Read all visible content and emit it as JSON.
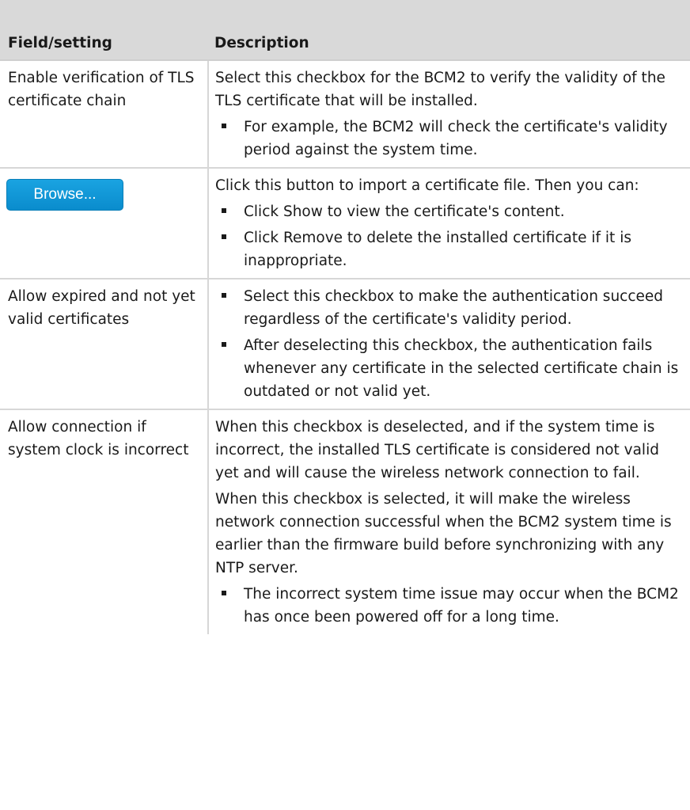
{
  "table": {
    "headers": {
      "field": "Field/setting",
      "description": "Description"
    },
    "rows": [
      {
        "field": "Enable verification of TLS certificate chain",
        "paragraphs": [
          "Select this checkbox for the BCM2 to verify the validity of the TLS certificate that will be installed."
        ],
        "bullets": [
          "For example, the BCM2 will check the certificate's validity period against the system time."
        ]
      },
      {
        "field_button": "Browse...",
        "paragraphs": [
          "Click this button to import a certificate file. Then you can:"
        ],
        "bullets": [
          "Click Show to view the certificate's content.",
          "Click Remove to delete the installed certificate if it is inappropriate."
        ]
      },
      {
        "field": "Allow expired and not yet valid certificates",
        "paragraphs": [],
        "bullets": [
          "Select this checkbox to make the authentication succeed regardless of the certificate's validity period.",
          "After deselecting this checkbox, the authentication fails whenever any certificate in the selected certificate chain is outdated or not valid yet."
        ]
      },
      {
        "field": "Allow connection if system clock is incorrect",
        "paragraphs": [
          "When this checkbox is deselected, and if the system time is incorrect, the installed TLS certificate is considered not valid yet and will cause the wireless network connection to fail.",
          "When this checkbox is selected, it will make the wireless network connection successful when the BCM2 system time is earlier than the firmware build before synchronizing with any NTP server."
        ],
        "bullets": [
          "The incorrect system time issue may occur when the BCM2 has once been powered off for a long time."
        ]
      }
    ]
  },
  "colors": {
    "header_bg": "#d9d9d9",
    "border": "#d7d7d7",
    "button_blue": "#1aa3e1"
  }
}
